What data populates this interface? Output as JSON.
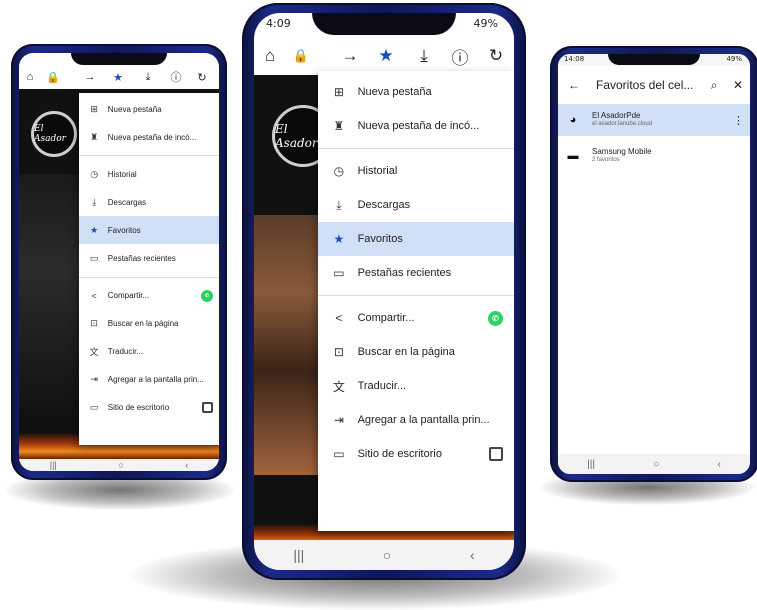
{
  "left_phone": {
    "status": {
      "time": "",
      "battery": ""
    },
    "site": {
      "logo": "El Asador"
    },
    "menu": [
      {
        "icon": "new-tab-icon",
        "label": "Nueva pestaña"
      },
      {
        "icon": "incognito-icon",
        "label": "Nueva pestaña de incó..."
      },
      {
        "icon": "history-icon",
        "label": "Historial"
      },
      {
        "icon": "download-icon",
        "label": "Descargas"
      },
      {
        "icon": "star-icon",
        "label": "Favoritos",
        "selected": true
      },
      {
        "icon": "recent-tabs-icon",
        "label": "Pestañas recientes"
      },
      {
        "icon": "share-icon",
        "label": "Compartir..."
      },
      {
        "icon": "find-icon",
        "label": "Buscar en la página"
      },
      {
        "icon": "translate-icon",
        "label": "Traducir..."
      },
      {
        "icon": "add-home-icon",
        "label": "Agregar a la pantalla prin..."
      },
      {
        "icon": "desktop-icon",
        "label": "Sitio de escritorio"
      }
    ]
  },
  "center_phone": {
    "status": {
      "time": "4:09",
      "battery": "49%"
    },
    "site": {
      "logo": "El Asador"
    },
    "menu": [
      {
        "icon": "new-tab-icon",
        "label": "Nueva pestaña"
      },
      {
        "icon": "incognito-icon",
        "label": "Nueva pestaña de incó..."
      },
      {
        "icon": "history-icon",
        "label": "Historial"
      },
      {
        "icon": "download-icon",
        "label": "Descargas"
      },
      {
        "icon": "star-icon",
        "label": "Favoritos",
        "selected": true
      },
      {
        "icon": "recent-tabs-icon",
        "label": "Pestañas recientes"
      },
      {
        "icon": "share-icon",
        "label": "Compartir..."
      },
      {
        "icon": "find-icon",
        "label": "Buscar en la página"
      },
      {
        "icon": "translate-icon",
        "label": "Traducir..."
      },
      {
        "icon": "add-home-icon",
        "label": "Agregar a la pantalla prin..."
      },
      {
        "icon": "desktop-icon",
        "label": "Sitio de escritorio"
      }
    ]
  },
  "right_phone": {
    "status": {
      "time": "14:08",
      "battery": "49%"
    },
    "title": "Favoritos del cel...",
    "bookmarks": [
      {
        "icon": "site-favicon-icon",
        "title": "El AsadorPde",
        "subtitle": "el asador.lanube.cloud",
        "selected": true
      },
      {
        "icon": "folder-icon",
        "title": "Samsung Mobile",
        "subtitle": "2 favoritos",
        "selected": false
      }
    ]
  },
  "colors": {
    "phone_frame": "#1b2a8a",
    "accent": "#1a4fb4",
    "selected_row": "#cfe0f7",
    "whatsapp": "#25d366"
  }
}
